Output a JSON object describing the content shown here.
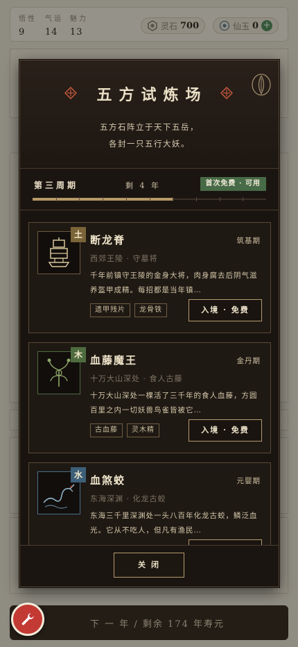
{
  "colors": {
    "accent": "#b69c6e",
    "modal_bg": "#191410",
    "free_badge": "#476a47",
    "fab": "#c23a33"
  },
  "stats": [
    {
      "label": "悟性",
      "value": "9"
    },
    {
      "label": "气运",
      "value": "14"
    },
    {
      "label": "魅力",
      "value": "13"
    }
  ],
  "currency": {
    "lingshi": {
      "icon": "spirit-stone-icon",
      "label": "灵石",
      "value": "700"
    },
    "xianyu": {
      "icon": "jade-icon",
      "label": "仙玉",
      "value": "0"
    },
    "add_icon": "plus-icon"
  },
  "modal": {
    "title": "五方试炼场",
    "subtitle_line1": "五方石阵立于天下五岳，",
    "subtitle_line2": "各封一只五行大妖。",
    "cycle_label": "第三周期",
    "cycle_year": "剩 4 年",
    "free_badge": "首次免费 · 可用",
    "cycle_progress": 0.6,
    "cards": [
      {
        "name": "断龙脊",
        "element": "土",
        "element_color": "#7a6438",
        "frame_color": "#6b5a3f",
        "realm": "筑基期",
        "location": "西郊王陵 · 守墓将",
        "desc": "千年前镇守王陵的金身大将，肉身腐去后阴气滋养盔甲成精。每招都是当年镇…",
        "tags": [
          "遗甲残片",
          "龙骨铁"
        ],
        "enter": "入境 · 免费",
        "icon": "stone-warrior-icon"
      },
      {
        "name": "血藤魔王",
        "element": "木",
        "element_color": "#4e6b3f",
        "frame_color": "#4e6b3f",
        "realm": "金丹期",
        "location": "十万大山深处 · 食人古藤",
        "desc": "十万大山深处一棵活了三千年的食人血藤，方圆百里之内一切妖兽鸟雀皆被它…",
        "tags": [
          "古血藤",
          "灵木精"
        ],
        "enter": "入境 · 免费",
        "icon": "blood-vine-icon"
      },
      {
        "name": "血煞蛟",
        "element": "水",
        "element_color": "#3d5f78",
        "frame_color": "#4a6f8a",
        "realm": "元婴期",
        "location": "东海深渊 · 化龙古蛟",
        "desc": "东海三千里深渊处一头八百年化龙古蛟，鳞泛血光。它从不吃人，但凡有渔民…",
        "tags": [],
        "enter": "",
        "icon": "sea-dragon-icon"
      }
    ],
    "close": "关闭",
    "seal_icon": "seal-emblem-icon"
  },
  "bottom": {
    "next_year": "下 一 年 / 剩余 174 年寿元",
    "fab_icon": "wrench-icon"
  }
}
